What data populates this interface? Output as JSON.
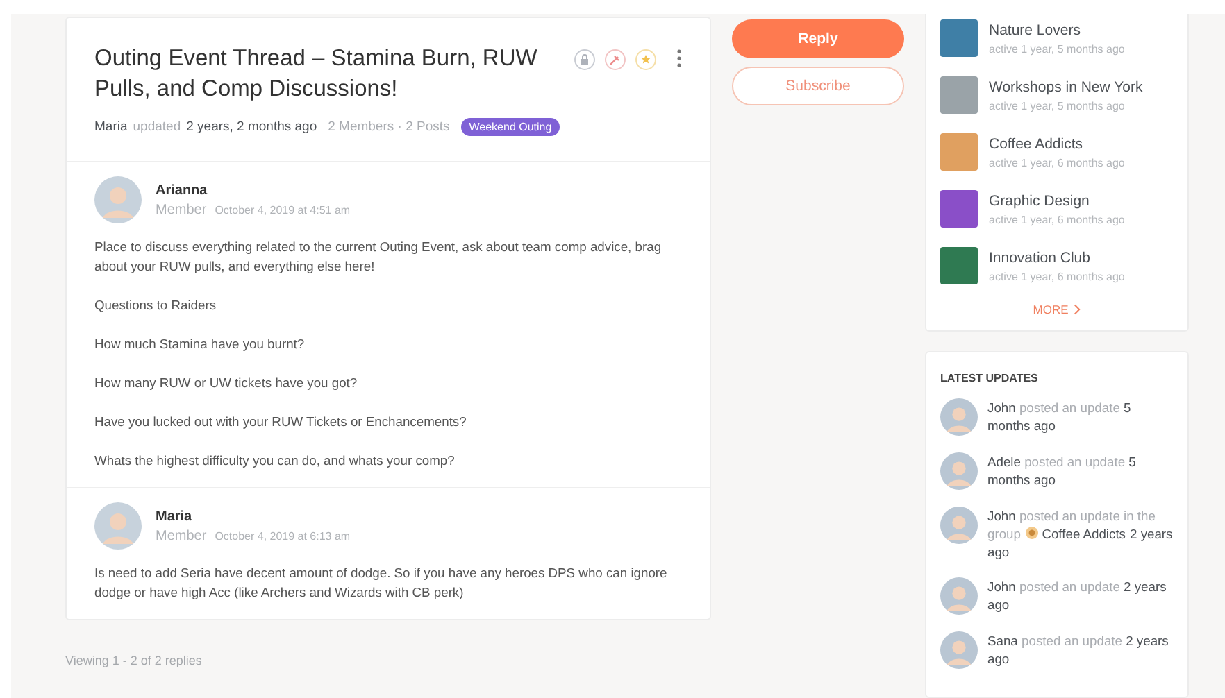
{
  "topic": {
    "title": "Outing Event Thread – Stamina Burn, RUW Pulls, and Comp Discussions!",
    "meta": {
      "author": "Maria",
      "action": "updated",
      "time": "2 years, 2 months ago",
      "counts": "2 Members · 2 Posts",
      "tag": "Weekend Outing"
    }
  },
  "replies": [
    {
      "author": "Arianna",
      "role": "Member",
      "date": "October 4, 2019 at 4:51 am",
      "paragraphs": [
        "Place to discuss everything related to the current Outing Event, ask about team comp advice, brag about your RUW pulls, and everything else here!",
        "Questions to Raiders",
        "How much Stamina have you burnt?",
        "How many RUW or UW tickets have you got?",
        "Have you lucked out with your RUW Tickets or Enchancements?",
        "Whats the highest difficulty you can do, and whats your comp?"
      ]
    },
    {
      "author": "Maria",
      "role": "Member",
      "date": "October 4, 2019 at 6:13 am",
      "paragraphs": [
        "Is need to add Seria have decent amount of dodge. So if you have any heroes DPS who can ignore dodge or have high Acc (like Archers and Wizards with CB perk)"
      ]
    }
  ],
  "pagination": "Viewing 1 - 2 of 2 replies",
  "actions": {
    "reply": "Reply",
    "subscribe": "Subscribe"
  },
  "groups": {
    "items": [
      {
        "name": "Nature Lovers",
        "active": "active 1 year, 5 months ago",
        "color": "#3f7fa6"
      },
      {
        "name": "Workshops in New York",
        "active": "active 1 year, 5 months ago",
        "color": "#9aa3a8"
      },
      {
        "name": "Coffee Addicts",
        "active": "active 1 year, 6 months ago",
        "color": "#e0a060"
      },
      {
        "name": "Graphic Design",
        "active": "active 1 year, 6 months ago",
        "color": "#8a4fc8"
      },
      {
        "name": "Innovation Club",
        "active": "active 1 year, 6 months ago",
        "color": "#2f7a52"
      }
    ],
    "more": "MORE"
  },
  "latest_updates": {
    "title": "LATEST UPDATES",
    "items": [
      {
        "name": "John",
        "action": "posted an update",
        "time": "5 months ago"
      },
      {
        "name": "Adele",
        "action": "posted an update",
        "time": "5 months ago"
      },
      {
        "name": "John",
        "action": "posted an update in the group",
        "group": "Coffee Addicts",
        "time": "2 years ago"
      },
      {
        "name": "John",
        "action": "posted an update",
        "time": "2 years ago"
      },
      {
        "name": "Sana",
        "action": "posted an update",
        "time": "2 years ago"
      }
    ]
  }
}
